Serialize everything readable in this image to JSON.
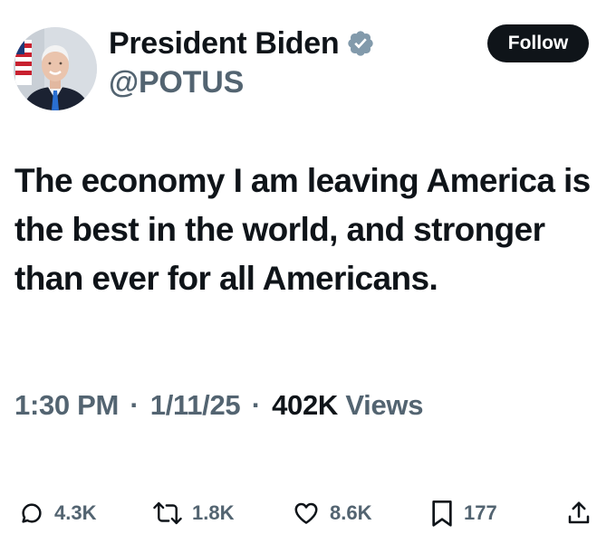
{
  "author": {
    "display_name": "President Biden",
    "handle": "@POTUS",
    "avatar": "profile-photo",
    "verified_icon": "verified-badge-icon",
    "verified_color": "#829aab"
  },
  "follow_button": {
    "label": "Follow"
  },
  "tweet": {
    "text": "The economy I am leaving America is the best in the world, and stronger than ever for all Americans."
  },
  "meta": {
    "time": "1:30 PM",
    "separator": "·",
    "date": "1/11/25",
    "views_count": "402K",
    "views_label": "Views"
  },
  "actions": {
    "reply": {
      "icon": "reply-icon",
      "count": "4.3K"
    },
    "repost": {
      "icon": "repost-icon",
      "count": "1.8K"
    },
    "like": {
      "icon": "heart-icon",
      "count": "8.6K"
    },
    "bookmark": {
      "icon": "bookmark-icon",
      "count": "177"
    },
    "share": {
      "icon": "share-icon"
    }
  },
  "colors": {
    "text_primary": "#0f1419",
    "text_secondary": "#536471",
    "button_bg": "#0f1419",
    "button_text": "#ffffff"
  }
}
